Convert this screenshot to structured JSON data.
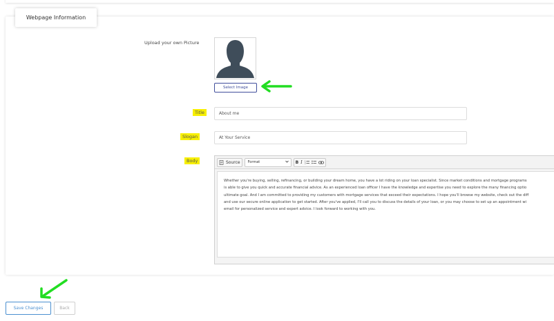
{
  "panel": {
    "title": "Webpage Information"
  },
  "picture": {
    "label": "Upload your own Picture",
    "select_label": "Select Image"
  },
  "title_field": {
    "label": "Title",
    "value": "About me"
  },
  "slogan_field": {
    "label": "Slogan",
    "value": "At Your Service"
  },
  "body_field": {
    "label": "Body",
    "toolbar": {
      "source_label": "Source",
      "format_label": "Format",
      "bold_label": "B",
      "italic_label": "I"
    },
    "lines": [
      "Whether you're buying, selling, refinancing, or building your dream home, you have a lot riding on your loan specialist. Since market conditions and mortgage programs",
      "is able to give you quick and accurate financial advice. As an experienced loan officer I have the knowledge and expertise you need to explore the many financing optio",
      "ultimate goal. And I am committed to providing my customers with mortgage services that exceed their expectations. I hope you'll browse my website, check out the diff",
      "and use our secure online application to get started. After you've applied, I'll call you to discuss the details of your loan, or you may choose to set up an appointment wi",
      "email for personalized service and expert advice. I look forward to working with you."
    ]
  },
  "actions": {
    "save_label": "Save Changes",
    "back_label": "Back"
  },
  "colors": {
    "highlight": "#f7ef00",
    "annotation_arrow": "#22dd22",
    "primary": "#4a8fd0"
  }
}
